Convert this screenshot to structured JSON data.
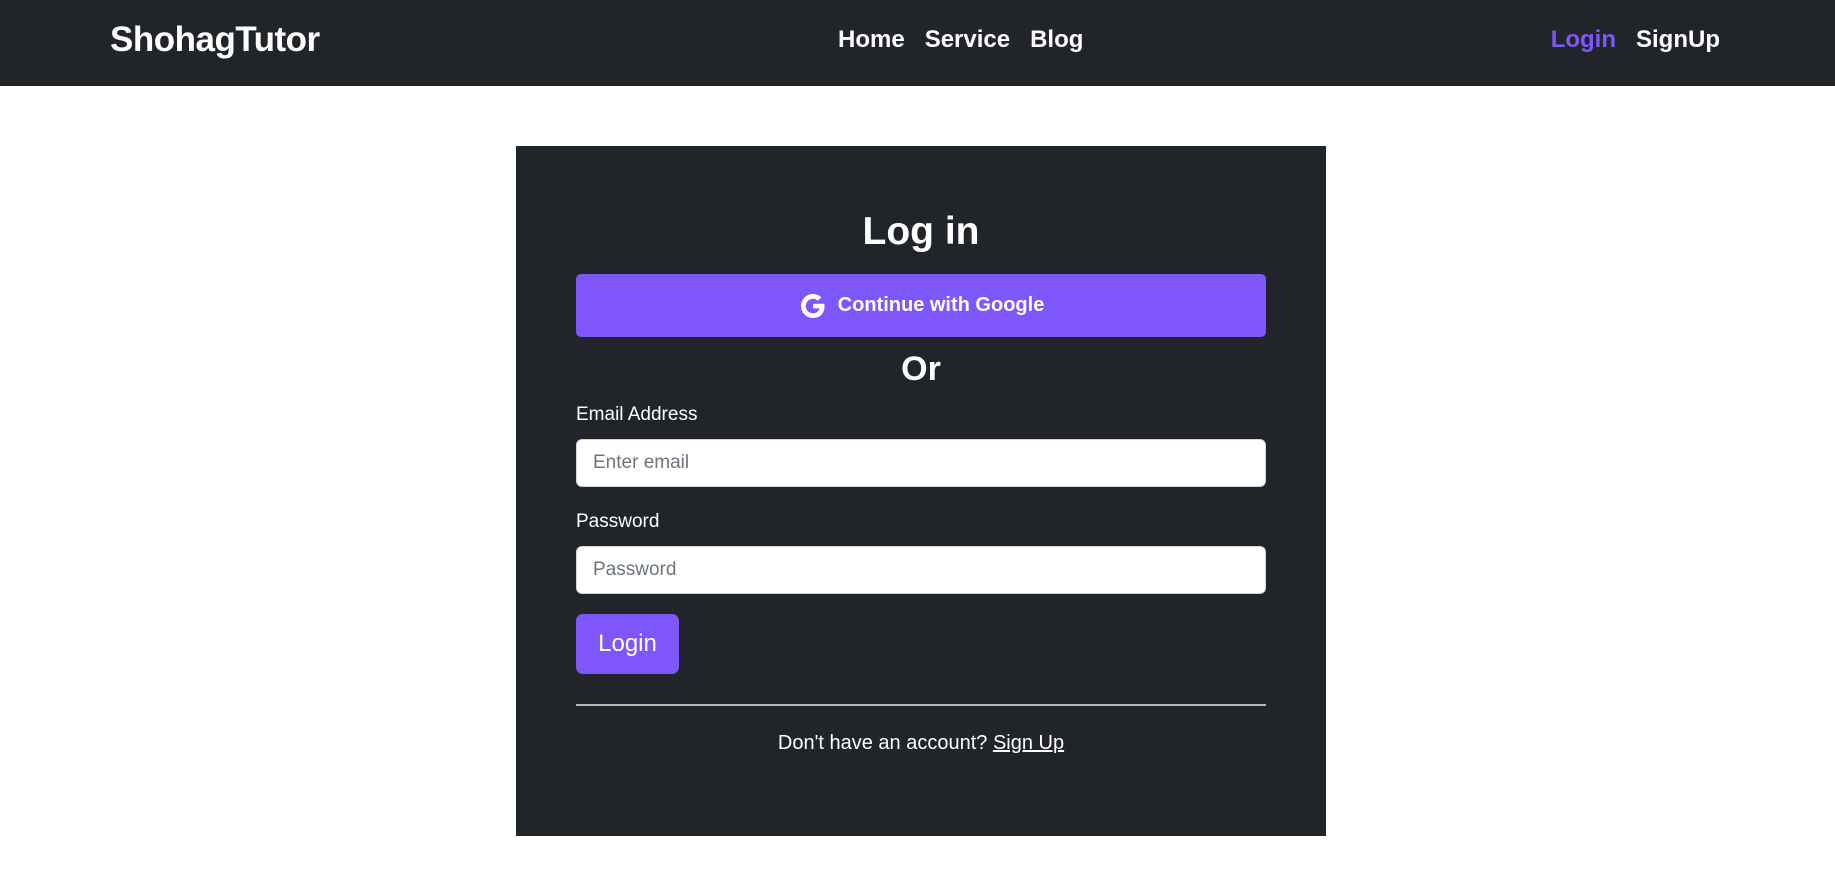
{
  "colors": {
    "navbar_bg": "#212529",
    "card_bg": "#212529",
    "accent": "#7f56fb",
    "active_nav": "#7f56fb",
    "text": "#ffffff",
    "page_bg": "#ffffff"
  },
  "navbar": {
    "brand": "ShohagTutor",
    "links": [
      {
        "label": "Home"
      },
      {
        "label": "Service"
      },
      {
        "label": "Blog"
      }
    ],
    "auth_links": [
      {
        "label": "Login",
        "active": true
      },
      {
        "label": "SignUp",
        "active": false
      }
    ]
  },
  "login_card": {
    "title": "Log in",
    "google_button": {
      "label": "Continue with Google",
      "icon": "google-icon"
    },
    "separator": "Or",
    "email": {
      "label": "Email Address",
      "placeholder": "Enter email",
      "value": ""
    },
    "password": {
      "label": "Password",
      "placeholder": "Password",
      "value": ""
    },
    "submit_label": "Login",
    "signup_prompt": "Don't have an account?",
    "signup_link": "Sign Up"
  }
}
